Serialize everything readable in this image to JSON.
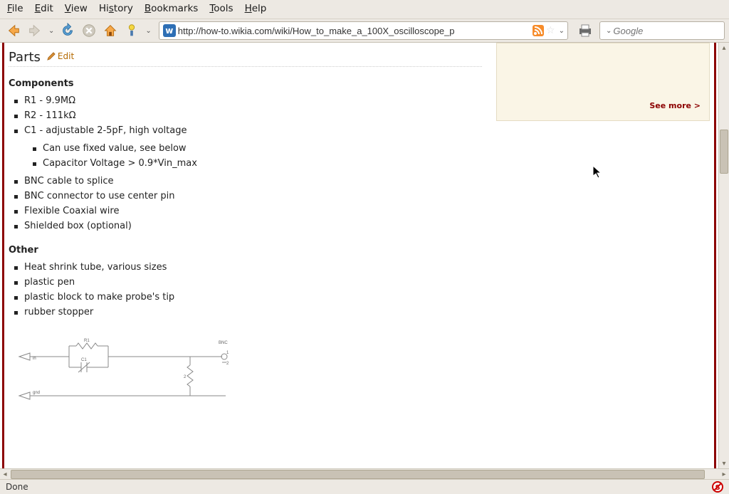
{
  "menubar": {
    "file": "File",
    "edit": "Edit",
    "view": "View",
    "history": "History",
    "bookmarks": "Bookmarks",
    "tools": "Tools",
    "help": "Help"
  },
  "toolbar": {
    "url": "http://how-to.wikia.com/wiki/How_to_make_a_100X_oscilloscope_p",
    "search_placeholder": "Google"
  },
  "sidebar": {
    "see_more": "See more >"
  },
  "heading": {
    "parts": "Parts",
    "edit": "Edit"
  },
  "sections": {
    "components_title": "Components",
    "components": [
      "R1 - 9.9MΩ",
      "R2 - 111kΩ",
      "C1 - adjustable 2-5pF, high voltage"
    ],
    "c1_sub": [
      "Can use fixed value, see below",
      "Capacitor Voltage > 0.9*Vin_max"
    ],
    "components2": [
      "BNC cable to splice",
      "BNC connector to use center pin",
      "Flexible Coaxial wire",
      "Shielded box (optional)"
    ],
    "other_title": "Other",
    "other": [
      "Heat shrink tube, various sizes",
      "plastic pen",
      "plastic block to make probe's tip",
      "rubber stopper"
    ]
  },
  "schematic": {
    "r1": "R1",
    "c1": "C1",
    "in": "in",
    "gnd": "gnd",
    "bnc": "BNC",
    "n2": "2",
    "n1": "1"
  },
  "status": {
    "done": "Done"
  }
}
